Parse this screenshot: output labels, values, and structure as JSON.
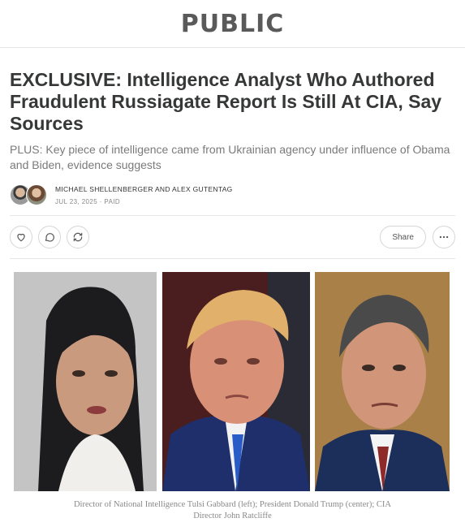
{
  "site": {
    "logo_text": "PUBLIC"
  },
  "article": {
    "title": "EXCLUSIVE: Intelligence Analyst Who Authored Fraudulent Russiagate Report Is Still At CIA, Say Sources",
    "subtitle": "PLUS: Key piece of intelligence came from Ukrainian agency under influence of Obama and Biden, evidence suggests",
    "authors": "MICHAEL SHELLENBERGER AND ALEX GUTENTAG",
    "date": "JUL 23, 2025",
    "separator": "·",
    "access": "PAID"
  },
  "actions": {
    "share_label": "Share",
    "icons": [
      "heart-icon",
      "comment-icon",
      "restack-icon",
      "ellipsis-icon"
    ]
  },
  "image": {
    "caption": "Director of National Intelligence Tulsi Gabbard (left); President Donald Trump (center); CIA Director John Ratcliffe"
  },
  "colors": {
    "headline": "#363737",
    "subtitle": "#7a7a7a",
    "border": "#e6e6e6"
  }
}
